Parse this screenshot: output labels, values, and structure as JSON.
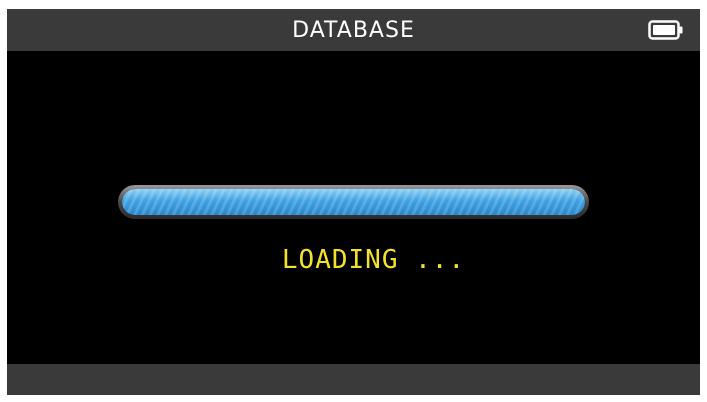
{
  "header": {
    "title": "DATABASE",
    "battery_icon": "battery-icon"
  },
  "main": {
    "loading_text": "LOADING ...",
    "progress": {
      "fraction": 1.0
    }
  },
  "colors": {
    "header_bg": "#3a3a3a",
    "screen_bg": "#000000",
    "progress_accent": "#3fa2e2",
    "loading_text": "#f2e22a"
  }
}
